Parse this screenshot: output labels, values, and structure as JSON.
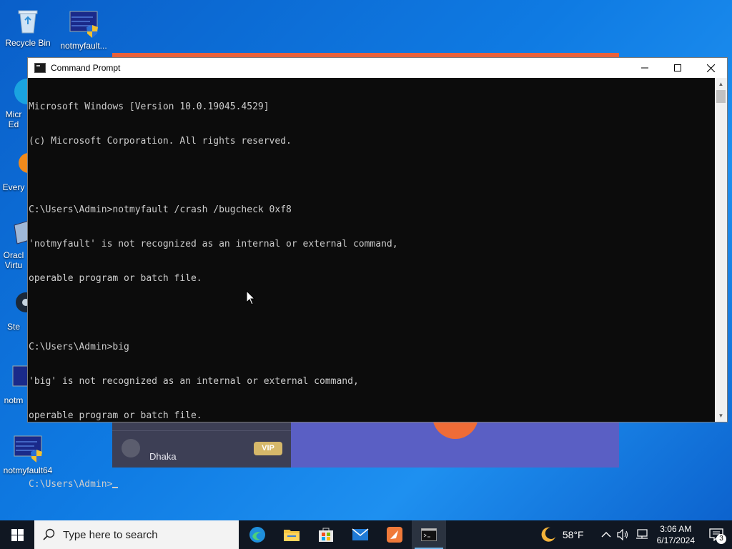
{
  "desktop": {
    "icons": [
      {
        "label": "Recycle Bin"
      },
      {
        "label": "notmyfault..."
      },
      {
        "label": "Micr\nEd"
      },
      {
        "label": "Every"
      },
      {
        "label": "Oracl\nVirtu"
      },
      {
        "label": "Ste"
      },
      {
        "label": "notm"
      },
      {
        "label": "notmyfault64"
      }
    ]
  },
  "background_app": {
    "location_label": "Dhaka",
    "badge": "VIP"
  },
  "cmd": {
    "title": "Command Prompt",
    "lines": [
      "Microsoft Windows [Version 10.0.19045.4529]",
      "(c) Microsoft Corporation. All rights reserved.",
      "",
      "C:\\Users\\Admin>notmyfault /crash /bugcheck 0xf8",
      "'notmyfault' is not recognized as an internal or external command,",
      "operable program or batch file.",
      "",
      "C:\\Users\\Admin>big",
      "'big' is not recognized as an internal or external command,",
      "operable program or batch file.",
      ""
    ],
    "prompt": "C:\\Users\\Admin>"
  },
  "taskbar": {
    "search_placeholder": "Type here to search",
    "weather": "58°F",
    "time": "3:06 AM",
    "date": "6/17/2024",
    "notification_count": "3"
  }
}
